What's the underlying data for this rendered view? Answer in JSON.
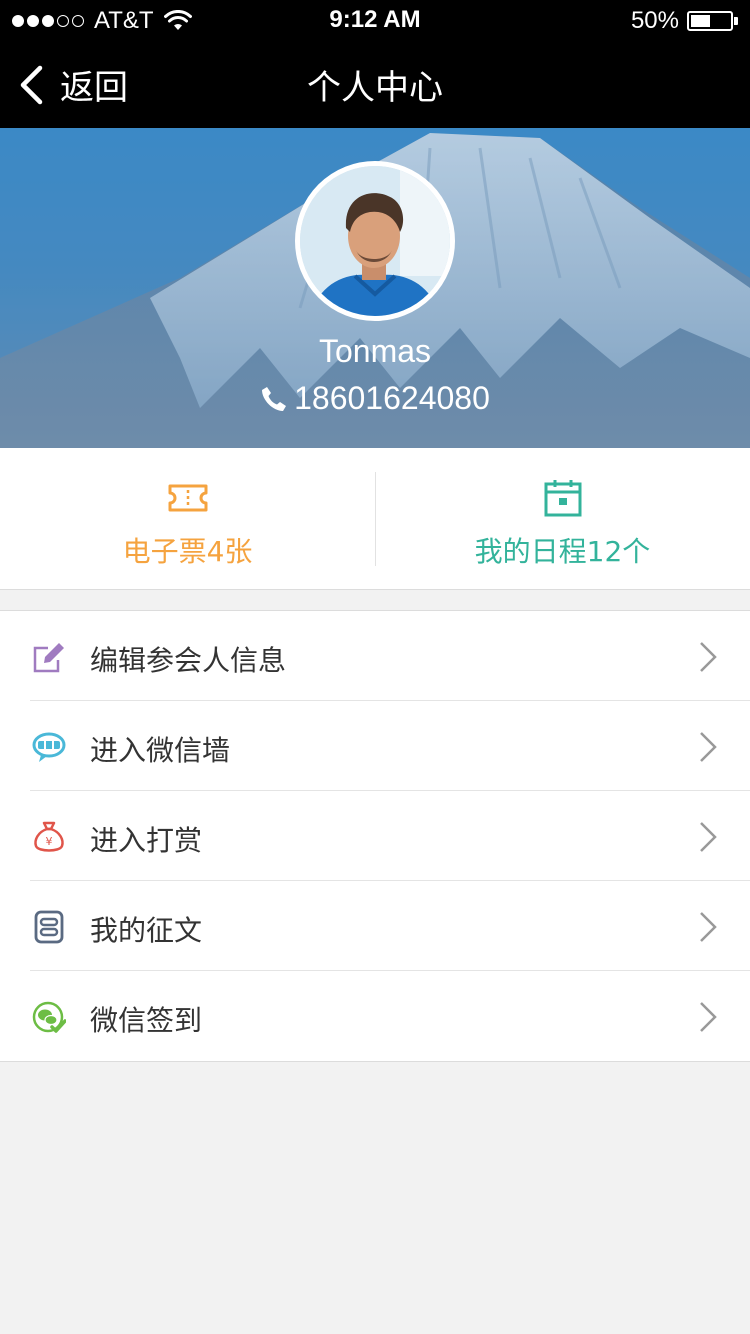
{
  "status_bar": {
    "carrier": "AT&T",
    "time": "9:12 AM",
    "battery": "50%",
    "battery_level": 0.5,
    "signal_bars": 3
  },
  "nav": {
    "back_label": "返回",
    "title": "个人中心"
  },
  "profile": {
    "name": "Tonmas",
    "phone": "18601624080"
  },
  "stats": {
    "tickets_label": "电子票4张",
    "schedule_label": "我的日程12个",
    "tickets_color": "#f5a33f",
    "schedule_color": "#33b39b"
  },
  "menu": {
    "items": [
      {
        "label": "编辑参会人信息",
        "icon": "edit-icon",
        "color": "#a07bc0"
      },
      {
        "label": "进入微信墙",
        "icon": "chat-wall-icon",
        "color": "#4ab8d8"
      },
      {
        "label": "进入打赏",
        "icon": "money-bag-icon",
        "color": "#e0554a"
      },
      {
        "label": "我的征文",
        "icon": "document-icon",
        "color": "#5a6a82"
      },
      {
        "label": "微信签到",
        "icon": "wechat-checkin-icon",
        "color": "#6dbd45"
      }
    ]
  }
}
